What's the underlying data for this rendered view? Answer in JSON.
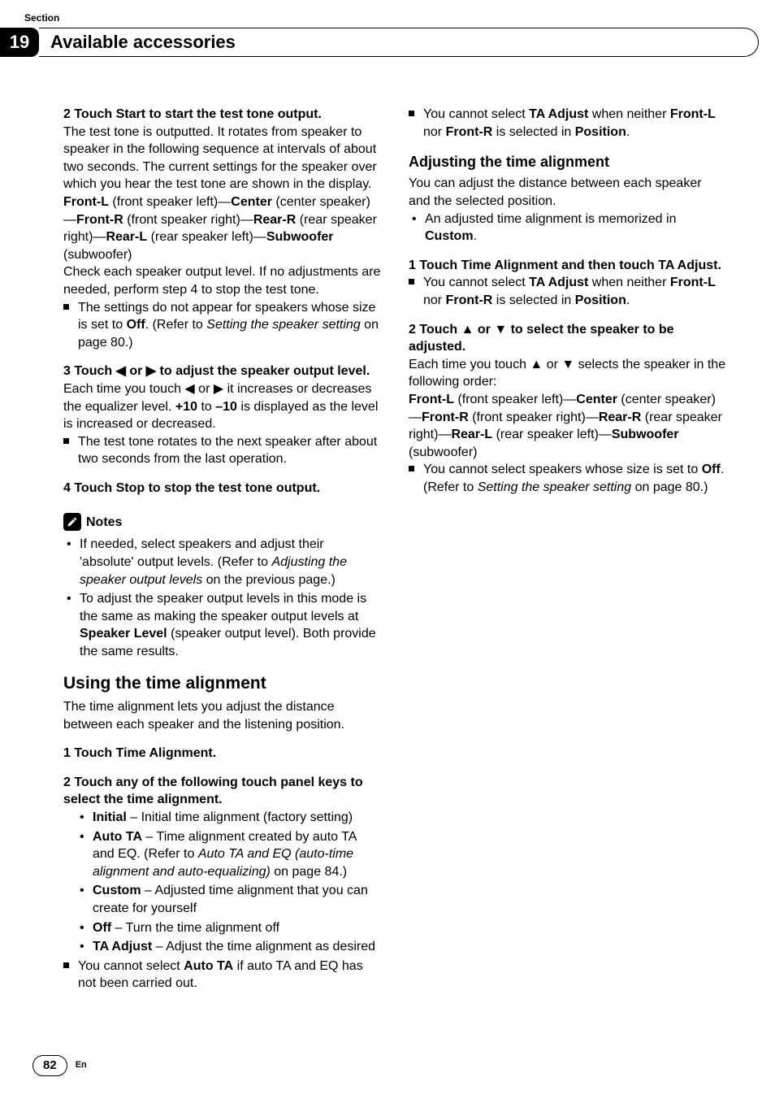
{
  "meta": {
    "section_label": "Section",
    "chapter_number": "19",
    "chapter_title": "Available accessories",
    "page_number": "82",
    "lang": "En"
  },
  "left": {
    "step2_head": "2    Touch Start to start the test tone output.",
    "step2_p1": "The test tone is outputted. It rotates from speaker to speaker in the following sequence at intervals of about two seconds. The current settings for the speaker over which you hear the test tone are shown in the display.",
    "seq": {
      "frontL_b": "Front-L",
      "frontL_t": " (front speaker left)—",
      "center_b": "Center",
      "center_t": " (center speaker)—",
      "frontR_b": "Front-R",
      "frontR_t": " (front speaker right)—",
      "rearR_b": "Rear-R",
      "rearR_t": " (rear speaker right)—",
      "rearL_b": "Rear-L",
      "rearL_t": " (rear speaker left)—",
      "sub_b": "Subwoofer",
      "sub_t": " (subwoofer)"
    },
    "step2_p3": "Check each speaker output level. If no adjustments are needed, perform step 4 to stop the test tone.",
    "step2_note_a": "The settings do not appear for speakers whose size is set to ",
    "step2_note_off": "Off",
    "step2_note_b": ". (Refer to ",
    "step2_note_ref": "Setting the speaker setting",
    "step2_note_c": " on page 80.)",
    "step3_head": "3    Touch ◀ or ▶ to adjust the speaker output level.",
    "step3_p_a": "Each time you touch ◀ or ▶ it increases or decreases the equalizer level. ",
    "step3_plus": "+10",
    "step3_to": " to ",
    "step3_minus": "–10",
    "step3_p_b": " is displayed as the level is increased or decreased.",
    "step3_note": "The test tone rotates to the next speaker after about two seconds from the last operation.",
    "step4_head": "4    Touch Stop to stop the test tone output.",
    "notes_label": "Notes",
    "note1_a": "If needed, select speakers and adjust their 'absolute' output levels. (Refer to ",
    "note1_ref": "Adjusting the speaker output levels",
    "note1_b": " on the previous page.)",
    "note2_a": "To adjust the speaker output levels in this mode is the same as making the speaker output levels at ",
    "note2_b": "Speaker Level",
    "note2_c": "  (speaker output level). Both provide the same results.",
    "h2": "Using the time alignment",
    "h2_p": "The time alignment lets you adjust the distance between each speaker and the listening position.",
    "ta_step1": "1    Touch Time Alignment."
  },
  "right": {
    "step2_head": "2    Touch any of the following touch panel keys to select the time alignment.",
    "opt_initial_b": "Initial",
    "opt_initial_t": " – Initial time alignment (factory setting)",
    "opt_auto_b": "Auto TA",
    "opt_auto_t_a": " – Time alignment created by auto TA and EQ. (Refer to ",
    "opt_auto_ref": "Auto TA and EQ (auto-time alignment and auto-equalizing)",
    "opt_auto_t_b": " on page 84.)",
    "opt_custom_b": "Custom",
    "opt_custom_t": " – Adjusted time alignment that you can create for yourself",
    "opt_off_b": "Off",
    "opt_off_t": " – Turn the time alignment off",
    "opt_adj_b": "TA Adjust",
    "opt_adj_t": " – Adjust the time alignment as desired",
    "sq1_a": "You cannot select ",
    "sq1_b": "Auto TA",
    "sq1_c": " if auto TA and EQ has not been carried out.",
    "sq2_a": "You cannot select ",
    "sq2_b": "TA Adjust",
    "sq2_c": " when neither ",
    "sq2_d": "Front-L",
    "sq2_e": " nor ",
    "sq2_f": "Front-R",
    "sq2_g": " is selected in ",
    "sq2_h": "Position",
    "sq2_i": ".",
    "h3": "Adjusting the time alignment",
    "h3_p": "You can adjust the distance between each speaker and the selected position.",
    "h3_bullet_a": "An adjusted time alignment is memorized in ",
    "h3_bullet_b": "Custom",
    "h3_bullet_c": ".",
    "ta2_step1": "1    Touch Time Alignment and then touch TA Adjust.",
    "ta2_note_a": "You cannot select ",
    "ta2_note_b": "TA Adjust",
    "ta2_note_c": " when neither ",
    "ta2_note_d": "Front-L",
    "ta2_note_e": " nor ",
    "ta2_note_f": "Front-R",
    "ta2_note_g": " is selected in ",
    "ta2_note_h": "Position",
    "ta2_note_i": ".",
    "ta2_step2": "2    Touch ▲ or ▼ to select the speaker to be adjusted.",
    "ta2_p": "Each time you touch ▲ or ▼ selects the speaker in the following order:",
    "seq": {
      "frontL_b": "Front-L",
      "frontL_t": " (front speaker left)—",
      "center_b": "Center",
      "center_t": " (center speaker)—",
      "frontR_b": "Front-R",
      "frontR_t": " (front speaker right)—",
      "rearR_b": "Rear-R",
      "rearR_t": " (rear speaker right)—",
      "rearL_b": "Rear-L",
      "rearL_t": " (rear speaker left)—",
      "sub_b": "Subwoofer",
      "sub_t": " (subwoofer)"
    },
    "ta2_sq_a": "You cannot select speakers whose size is set to ",
    "ta2_sq_b": "Off",
    "ta2_sq_c": ". (Refer to ",
    "ta2_sq_ref": "Setting the speaker setting",
    "ta2_sq_d": " on page 80.)"
  }
}
